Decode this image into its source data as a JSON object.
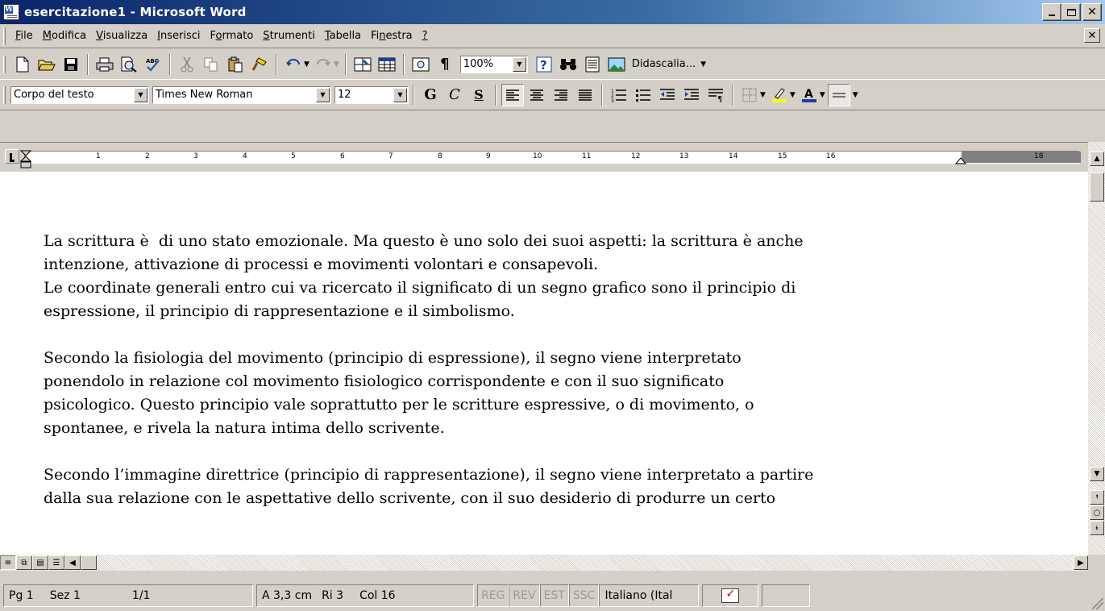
{
  "window": {
    "title": "esercitazione1 - Microsoft Word"
  },
  "menubar": {
    "items": [
      {
        "pre": "",
        "key": "F",
        "post": "ile"
      },
      {
        "pre": "",
        "key": "M",
        "post": "odifica"
      },
      {
        "pre": "",
        "key": "V",
        "post": "isualizza"
      },
      {
        "pre": "",
        "key": "I",
        "post": "nserisci"
      },
      {
        "pre": "F",
        "key": "o",
        "post": "rmato"
      },
      {
        "pre": "",
        "key": "S",
        "post": "trumenti"
      },
      {
        "pre": "",
        "key": "T",
        "post": "abella"
      },
      {
        "pre": "Fi",
        "key": "n",
        "post": "estra"
      },
      {
        "pre": "",
        "key": "?",
        "post": ""
      }
    ]
  },
  "standard_toolbar": {
    "zoom": "100%",
    "style_label": "Didascalia..."
  },
  "format_toolbar": {
    "style": "Corpo del testo",
    "font": "Times New Roman",
    "size": "12",
    "bold": "G",
    "italic": "C",
    "underline": "S"
  },
  "ruler": {
    "ticks": [
      "1",
      "2",
      "3",
      "4",
      "5",
      "6",
      "7",
      "8",
      "9",
      "10",
      "11",
      "12",
      "13",
      "14",
      "15",
      "16",
      "18"
    ]
  },
  "document": {
    "paragraphs": [
      [
        "La scrittura è  di uno stato emozionale. Ma questo è uno solo dei suoi aspetti: la scrittura è anche",
        "intenzione, attivazione di processi e movimenti volontari e consapevoli.",
        "Le coordinate generali entro cui va ricercato il significato di un segno grafico sono il principio di",
        "espressione, il principio di rappresentazione e il simbolismo."
      ],
      [
        "Secondo la fisiologia del movimento (principio di espressione), il segno viene interpretato",
        "ponendolo in relazione col movimento fisiologico corrispondente e con il suo significato",
        "psicologico. Questo principio vale soprattutto per le scritture espressive, o di movimento, o",
        "spontanee, e rivela la natura intima dello scrivente."
      ],
      [
        "Secondo l’immagine direttrice (principio di rappresentazione), il segno viene interpretato a partire",
        "dalla sua relazione con le aspettative dello scrivente, con il suo desiderio di produrre un certo"
      ]
    ]
  },
  "statusbar": {
    "page": "Pg 1",
    "section": "Sez 1",
    "pages": "1/1",
    "at": "A 3,3 cm",
    "line": "Ri 3",
    "col": "Col 16",
    "rec": "REG",
    "rev": "REV",
    "ext": "EST",
    "ovr": "SSC",
    "language": "Italiano (Ital"
  }
}
